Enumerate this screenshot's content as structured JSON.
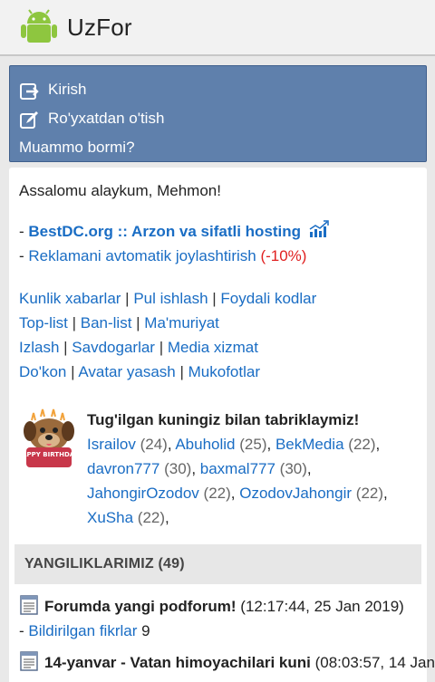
{
  "app": {
    "title": "UzFor",
    "logo_icon": "android-icon"
  },
  "login_box": {
    "items": [
      {
        "label": "Kirish",
        "icon": "login-icon"
      },
      {
        "label": "Ro'yxatdan o'tish",
        "icon": "register-icon"
      }
    ],
    "help": "Muammo bormi?"
  },
  "greeting": "Assalomu alaykum, Mehmon!",
  "ads": [
    {
      "prefix": "- ",
      "text": "BestDC.org :: Arzon va sifatli hosting",
      "icon": "chart-icon"
    },
    {
      "prefix": "- ",
      "text": "Reklamani avtomatik joylashtirish",
      "suffix": "(-10%)"
    }
  ],
  "links": [
    [
      "Kunlik xabarlar",
      "Pul ishlash",
      "Foydali kodlar"
    ],
    [
      "Top-list",
      "Ban-list",
      "Ma'muriyat"
    ],
    [
      "Izlash",
      "Savdogarlar",
      "Media xizmat"
    ],
    [
      "Do'kon",
      "Avatar yasash",
      "Mukofotlar"
    ]
  ],
  "link_separator": " | ",
  "birthday": {
    "title": "Tug'ilgan kuningiz bilan tabriklaymiz!",
    "icon": "birthday-dog-icon",
    "cake_text": "HAPPY BIRTHDAY!",
    "users": [
      {
        "name": "Israilov",
        "age": "(24)"
      },
      {
        "name": "Abuholid",
        "age": "(25)"
      },
      {
        "name": "BekMedia",
        "age": "(22)"
      },
      {
        "name": "davron777",
        "age": "(30)"
      },
      {
        "name": "baxmal777",
        "age": "(30)"
      },
      {
        "name": "JahongirOzodov",
        "age": "(22)"
      },
      {
        "name": "OzodovJahongir",
        "age": "(22)"
      },
      {
        "name": "XuSha",
        "age": "(22)"
      }
    ]
  },
  "news_section": {
    "title": "YANGILIKLARIMIZ (49)",
    "items": [
      {
        "title": "Forumda yangi podforum!",
        "time": "(12:17:44, 25 Jan 2019)",
        "sub_prefix": "- ",
        "sub_link": "Bildirilgan fikrlar",
        "sub_count": "9"
      },
      {
        "title": "14-yanvar - Vatan himoyachilari kuni",
        "time": "(08:03:57, 14 Jan"
      }
    ]
  },
  "colors": {
    "link": "#1a6dc4",
    "login_box_bg": "#5f80ac",
    "accent_red": "#e02020"
  }
}
